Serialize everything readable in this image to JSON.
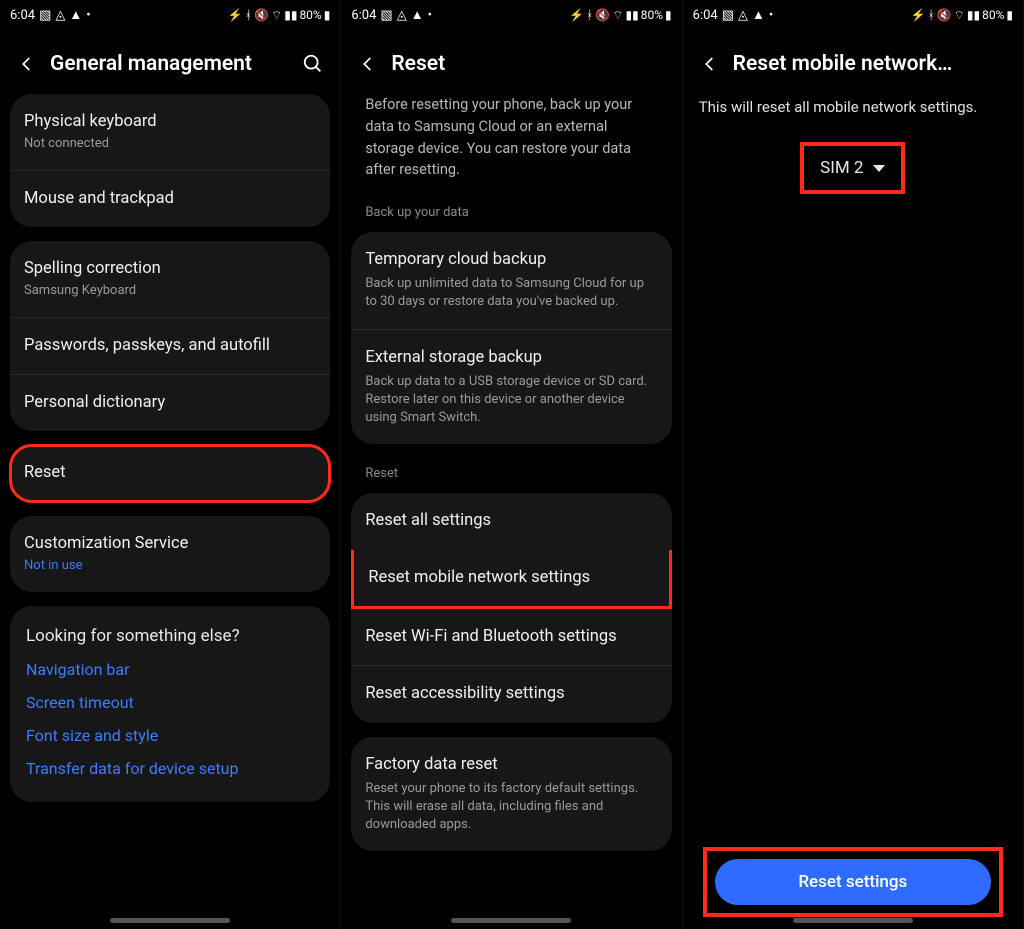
{
  "status": {
    "time": "6:04",
    "battery": "80%"
  },
  "panel1": {
    "title": "General management",
    "items": {
      "physical_keyboard": {
        "title": "Physical keyboard",
        "sub": "Not connected"
      },
      "mouse_trackpad": {
        "title": "Mouse and trackpad"
      },
      "spelling": {
        "title": "Spelling correction",
        "sub": "Samsung Keyboard"
      },
      "passwords": {
        "title": "Passwords, passkeys, and autofill"
      },
      "personal_dict": {
        "title": "Personal dictionary"
      },
      "reset": {
        "title": "Reset"
      },
      "customization": {
        "title": "Customization Service",
        "sub": "Not in use"
      }
    },
    "looking": {
      "title": "Looking for something else?",
      "links": [
        "Navigation bar",
        "Screen timeout",
        "Font size and style",
        "Transfer data for device setup"
      ]
    }
  },
  "panel2": {
    "title": "Reset",
    "lead": "Before resetting your phone, back up your data to Samsung Cloud or an external storage device. You can restore your data after resetting.",
    "section_backup": "Back up your data",
    "temp_backup": {
      "title": "Temporary cloud backup",
      "desc": "Back up unlimited data to Samsung Cloud for up to 30 days or restore data you've backed up."
    },
    "ext_backup": {
      "title": "External storage backup",
      "desc": "Back up data to a USB storage device or SD card. Restore later on this device or another device using Smart Switch."
    },
    "section_reset": "Reset",
    "reset_all": "Reset all settings",
    "reset_mobile": "Reset mobile network settings",
    "reset_wifi": "Reset Wi-Fi and Bluetooth settings",
    "reset_access": "Reset accessibility settings",
    "factory": {
      "title": "Factory data reset",
      "desc": "Reset your phone to its factory default settings. This will erase all data, including files and downloaded apps."
    }
  },
  "panel3": {
    "title": "Reset mobile network…",
    "desc": "This will reset all mobile network settings.",
    "sim": "SIM 2",
    "button": "Reset settings"
  }
}
